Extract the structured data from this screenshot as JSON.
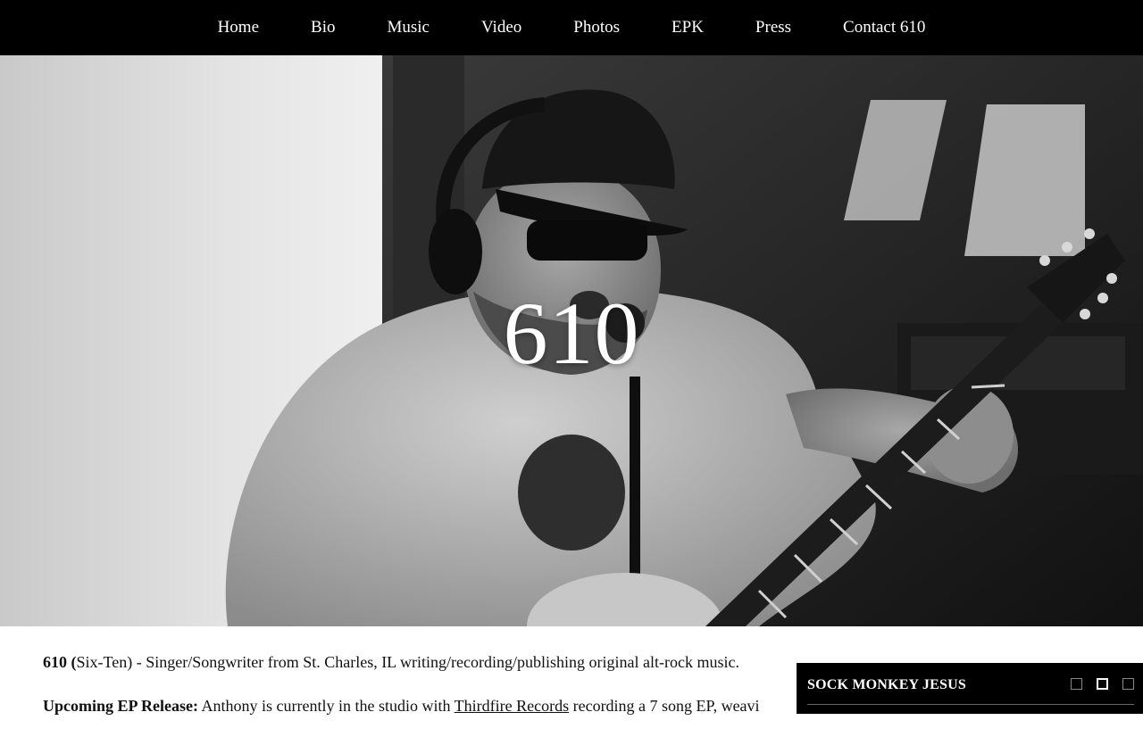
{
  "nav": {
    "items": [
      {
        "label": "Home"
      },
      {
        "label": "Bio"
      },
      {
        "label": "Music"
      },
      {
        "label": "Video"
      },
      {
        "label": "Photos"
      },
      {
        "label": "EPK"
      },
      {
        "label": "Press"
      },
      {
        "label": "Contact 610"
      }
    ]
  },
  "hero": {
    "title": "610"
  },
  "content": {
    "intro_bold": "610 (",
    "intro_text": "Six-Ten) - Singer/Songwriter from St. Charles, IL writing/recording/publishing original alt-rock music.",
    "ep_bold": "Upcoming EP Release:",
    "ep_text_before": " Anthony is currently in the studio with ",
    "ep_link": "Thirdfire Records",
    "ep_text_after": " recording a 7 song EP, weavi"
  },
  "player": {
    "title": "SOCK MONKEY JESUS",
    "controls": [
      "prev-icon",
      "stop-icon",
      "next-icon"
    ]
  }
}
